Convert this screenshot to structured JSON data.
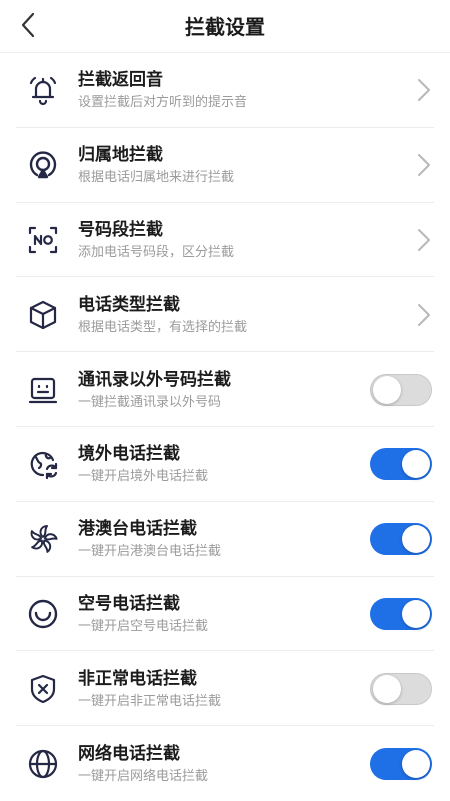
{
  "header": {
    "title": "拦截设置"
  },
  "colors": {
    "accent": "#1f6fe6",
    "icon": "#252845"
  },
  "rows": [
    {
      "title": "拦截返回音",
      "subtitle": "设置拦截后对方听到的提示音",
      "icon": "bell-icon",
      "control": "chevron"
    },
    {
      "title": "归属地拦截",
      "subtitle": "根据电话归属地来进行拦截",
      "icon": "location-icon",
      "control": "chevron"
    },
    {
      "title": "号码段拦截",
      "subtitle": "添加电话号码段，区分拦截",
      "icon": "number-scan-icon",
      "control": "chevron"
    },
    {
      "title": "电话类型拦截",
      "subtitle": "根据电话类型，有选择的拦截",
      "icon": "cube-icon",
      "control": "chevron"
    },
    {
      "title": "通讯录以外号码拦截",
      "subtitle": "一键拦截通讯录以外号码",
      "icon": "contact-card-icon",
      "control": "toggle",
      "on": false
    },
    {
      "title": "境外电话拦截",
      "subtitle": "一键开启境外电话拦截",
      "icon": "globe-refresh-icon",
      "control": "toggle",
      "on": true
    },
    {
      "title": "港澳台电话拦截",
      "subtitle": "一键开启港澳台电话拦截",
      "icon": "bauhinia-flower-icon",
      "control": "toggle",
      "on": true
    },
    {
      "title": "空号电话拦截",
      "subtitle": "一键开启空号电话拦截",
      "icon": "empty-circle-icon",
      "control": "toggle",
      "on": true
    },
    {
      "title": "非正常电话拦截",
      "subtitle": "一键开启非正常电话拦截",
      "icon": "shield-x-icon",
      "control": "toggle",
      "on": false
    },
    {
      "title": "网络电话拦截",
      "subtitle": "一键开启网络电话拦截",
      "icon": "network-globe-icon",
      "control": "toggle",
      "on": true
    }
  ]
}
